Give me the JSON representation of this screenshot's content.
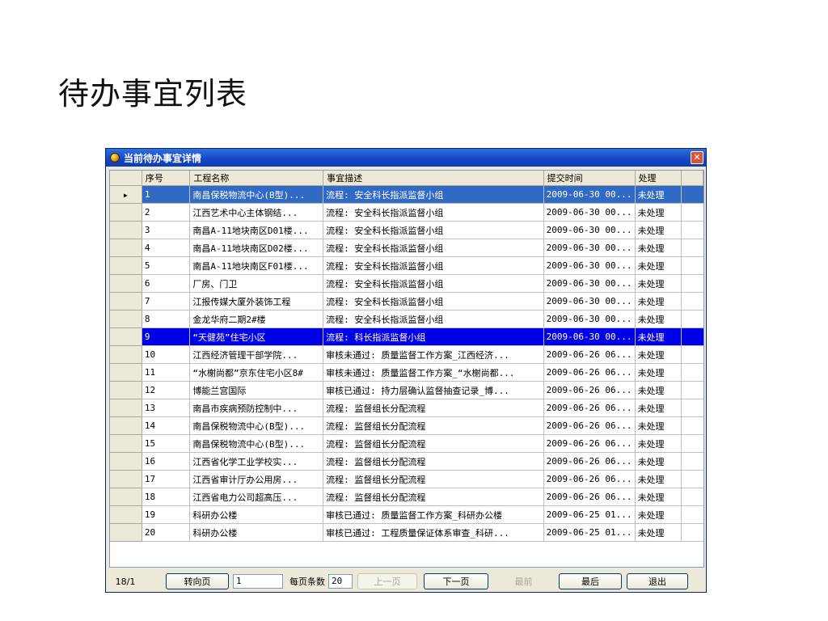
{
  "slide": {
    "title": "待办事宜列表"
  },
  "window": {
    "title": "当前待办事宜详情",
    "close_glyph": "✕"
  },
  "grid": {
    "columns": [
      "序号",
      "工程名称",
      "事宜描述",
      "提交时间",
      "处理"
    ],
    "current_row_marker": "▶",
    "rows": [
      [
        "1",
        "南昌保税物流中心(B型)...",
        "流程: 安全科长指派监督小组",
        "2009-06-30 00...",
        "未处理"
      ],
      [
        "2",
        "江西艺术中心主体钢结...",
        "流程: 安全科长指派监督小组",
        "2009-06-30 00...",
        "未处理"
      ],
      [
        "3",
        "南昌A-11地块南区D01楼...",
        "流程: 安全科长指派监督小组",
        "2009-06-30 00...",
        "未处理"
      ],
      [
        "4",
        "南昌A-11地块南区D02楼...",
        "流程: 安全科长指派监督小组",
        "2009-06-30 00...",
        "未处理"
      ],
      [
        "5",
        "南昌A-11地块南区F01楼...",
        "流程: 安全科长指派监督小组",
        "2009-06-30 00...",
        "未处理"
      ],
      [
        "6",
        "厂房、门卫",
        "流程: 安全科长指派监督小组",
        "2009-06-30 00...",
        "未处理"
      ],
      [
        "7",
        "江报传媒大厦外装饰工程",
        "流程: 安全科长指派监督小组",
        "2009-06-30 00...",
        "未处理"
      ],
      [
        "8",
        "金龙华府二期2#楼",
        "流程: 安全科长指派监督小组",
        "2009-06-30 00...",
        "未处理"
      ],
      [
        "9",
        "“天健苑”住宅小区",
        "流程: 科长指派监督小组",
        "2009-06-30 00...",
        "未处理"
      ],
      [
        "10",
        "江西经济管理干部学院...",
        "审核未通过: 质量监督工作方案_江西经济...",
        "2009-06-26 06...",
        "未处理"
      ],
      [
        "11",
        "“水榭尚都”京东住宅小区8#",
        "审核未通过: 质量监督工作方案_“水榭尚都...",
        "2009-06-26 06...",
        "未处理"
      ],
      [
        "12",
        "博能兰宫国际",
        "审核已通过: 持力层确认监督抽查记录_博...",
        "2009-06-26 06...",
        "未处理"
      ],
      [
        "13",
        "南昌市疾病预防控制中...",
        "流程: 监督组长分配流程",
        "2009-06-26 06...",
        "未处理"
      ],
      [
        "14",
        "南昌保税物流中心(B型)...",
        "流程: 监督组长分配流程",
        "2009-06-26 06...",
        "未处理"
      ],
      [
        "15",
        "南昌保税物流中心(B型)...",
        "流程: 监督组长分配流程",
        "2009-06-26 06...",
        "未处理"
      ],
      [
        "16",
        "江西省化学工业学校实...",
        "流程: 监督组长分配流程",
        "2009-06-26 06...",
        "未处理"
      ],
      [
        "17",
        "江西省审计厅办公用房...",
        "流程: 监督组长分配流程",
        "2009-06-26 06...",
        "未处理"
      ],
      [
        "18",
        "江西省电力公司超高压...",
        "流程: 监督组长分配流程",
        "2009-06-26 06...",
        "未处理"
      ],
      [
        "19",
        "科研办公楼",
        "审核已通过: 质量监督工作方案_科研办公楼",
        "2009-06-25 01...",
        "未处理"
      ],
      [
        "20",
        "科研办公楼",
        "审核已通过: 工程质量保证体系审查_科研...",
        "2009-06-25 01...",
        "未处理"
      ]
    ]
  },
  "footer": {
    "page_info": "18/1",
    "goto_label": "转向页",
    "goto_value": "1",
    "per_page_label": "每页条数",
    "per_page_value": "20",
    "prev_label": "上一页",
    "next_label": "下一页",
    "first_label": "最前",
    "last_label": "最后",
    "exit_label": "退出"
  },
  "colors": {
    "titlebar": "#1649c8",
    "selected_row": "#316ac5",
    "highlight_row": "#0000e8"
  }
}
